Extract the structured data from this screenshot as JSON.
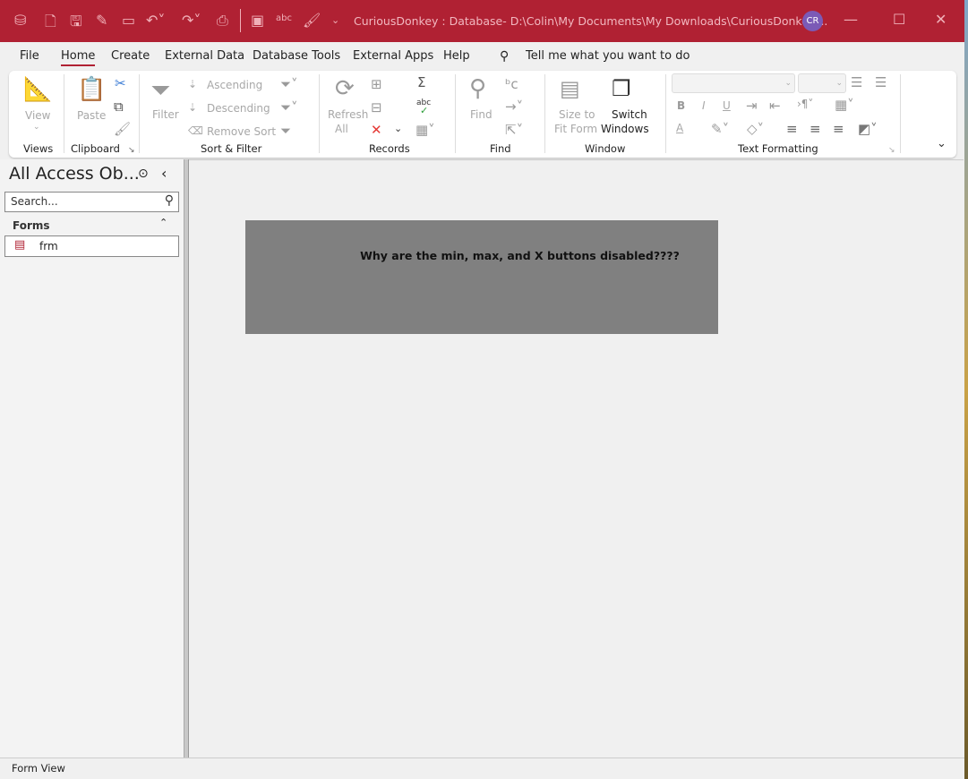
{
  "window": {
    "title": "CuriousDonkey : Database- D:\\Colin\\My Documents\\My Downloads\\CuriousDonkey....",
    "avatar": "CR",
    "accent": "#b02133"
  },
  "tabs": [
    "File",
    "Home",
    "Create",
    "External Data",
    "Database Tools",
    "External Apps",
    "Help"
  ],
  "active_tab": "Home",
  "tell_me": "Tell me what you want to do",
  "ribbon": {
    "views": {
      "label": "Views",
      "view": "View"
    },
    "clipboard": {
      "label": "Clipboard",
      "paste": "Paste"
    },
    "sort_filter": {
      "label": "Sort & Filter",
      "filter": "Filter",
      "ascending": "Ascending",
      "descending": "Descending",
      "remove_sort": "Remove Sort"
    },
    "records": {
      "label": "Records",
      "refresh": "Refresh",
      "all": "All",
      "spell": "abc"
    },
    "find": {
      "label": "Find",
      "find": "Find"
    },
    "window": {
      "label": "Window",
      "size_to": "Size to",
      "fit_form": "Fit Form",
      "switch": "Switch",
      "windows": "Windows"
    },
    "text_formatting": {
      "label": "Text Formatting",
      "bold": "B",
      "italic": "I",
      "underline": "U",
      "font_color": "A"
    }
  },
  "nav": {
    "title": "All Access Ob...",
    "search_placeholder": "Search...",
    "section": "Forms",
    "items": [
      {
        "label": "frm"
      }
    ]
  },
  "form": {
    "text": "Why are the min, max, and X buttons disabled????"
  },
  "status": "Form View"
}
